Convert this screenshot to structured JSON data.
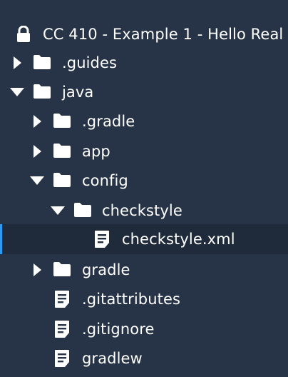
{
  "header": {
    "title": "CC 410 - Example 1 - Hello Real",
    "icon": "lock-icon"
  },
  "tree": {
    "items": [
      {
        "label": ".guides",
        "type": "folder",
        "expanded": false
      },
      {
        "label": "java",
        "type": "folder",
        "expanded": true
      },
      {
        "label": ".gradle",
        "type": "folder",
        "expanded": false
      },
      {
        "label": "app",
        "type": "folder",
        "expanded": false
      },
      {
        "label": "config",
        "type": "folder",
        "expanded": true
      },
      {
        "label": "checkstyle",
        "type": "folder",
        "expanded": true
      },
      {
        "label": "checkstyle.xml",
        "type": "file",
        "selected": true
      },
      {
        "label": "gradle",
        "type": "folder",
        "expanded": false
      },
      {
        "label": ".gitattributes",
        "type": "file"
      },
      {
        "label": ".gitignore",
        "type": "file"
      },
      {
        "label": "gradlew",
        "type": "file"
      }
    ]
  },
  "colors": {
    "background": "#273448",
    "selected_background": "#1f2a3b",
    "selected_accent": "#2f9bf0",
    "text": "#ffffff"
  }
}
